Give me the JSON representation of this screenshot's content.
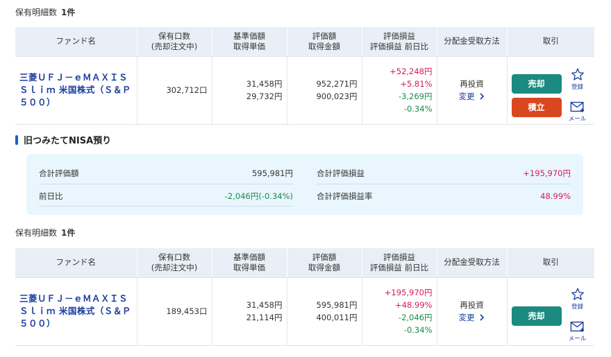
{
  "holdings_count": {
    "label": "保有明細数",
    "value": "1件"
  },
  "table_headers": {
    "fund": "ファンド名",
    "units_1": "保有口数",
    "units_2": "(売却注文中)",
    "price_1": "基準価額",
    "price_2": "取得単価",
    "eval_1": "評価額",
    "eval_2": "取得金額",
    "pl_1": "評価損益",
    "pl_2": "評価損益 前日比",
    "dist": "分配金受取方法",
    "trade": "取引"
  },
  "fund1": {
    "name": "三菱ＵＦＪ－ｅＭＡＸＩＳ Ｓｌｉｍ 米国株式（Ｓ＆Ｐ５００）",
    "units": "302,712口",
    "nav": "31,458円",
    "avg_cost": "29,732円",
    "eval": "952,271円",
    "cost": "900,023円",
    "pl": "+52,248円",
    "pl_pct": "+5.81%",
    "day": "-3,269円",
    "day_pct": "-0.34%",
    "dist_method": "再投資",
    "change_link": "変更",
    "sell": "売却",
    "buy": "積立",
    "register": "登録",
    "mail": "メール"
  },
  "section_title": "旧つみたてNISA預り",
  "summary": {
    "total_eval_label": "合計評価額",
    "total_eval": "595,981円",
    "day_label": "前日比",
    "day_value": "-2,046円(-0.34%)",
    "total_pl_label": "合計評価損益",
    "total_pl": "+195,970円",
    "pl_rate_label": "合計評価損益率",
    "pl_rate": "48.99%"
  },
  "holdings_count2": {
    "label": "保有明細数",
    "value": "1件"
  },
  "fund2": {
    "name": "三菱ＵＦＪ－ｅＭＡＸＩＳ Ｓｌｉｍ 米国株式（Ｓ＆Ｐ５００）",
    "units": "189,453口",
    "nav": "31,458円",
    "avg_cost": "21,114円",
    "eval": "595,981円",
    "cost": "400,011円",
    "pl": "+195,970円",
    "pl_pct": "+48.99%",
    "day": "-2,046円",
    "day_pct": "-0.34%",
    "dist_method": "再投資",
    "change_link": "変更",
    "sell": "売却",
    "register": "登録",
    "mail": "メール"
  },
  "colors": {
    "accent_blue": "#1a3d9e",
    "sell": "#1b8a80",
    "buy": "#d9471f",
    "positive": "#d6195a",
    "negative": "#1a8a4a"
  },
  "icons": [
    "star-icon",
    "mail-icon",
    "chevron-right-icon"
  ]
}
